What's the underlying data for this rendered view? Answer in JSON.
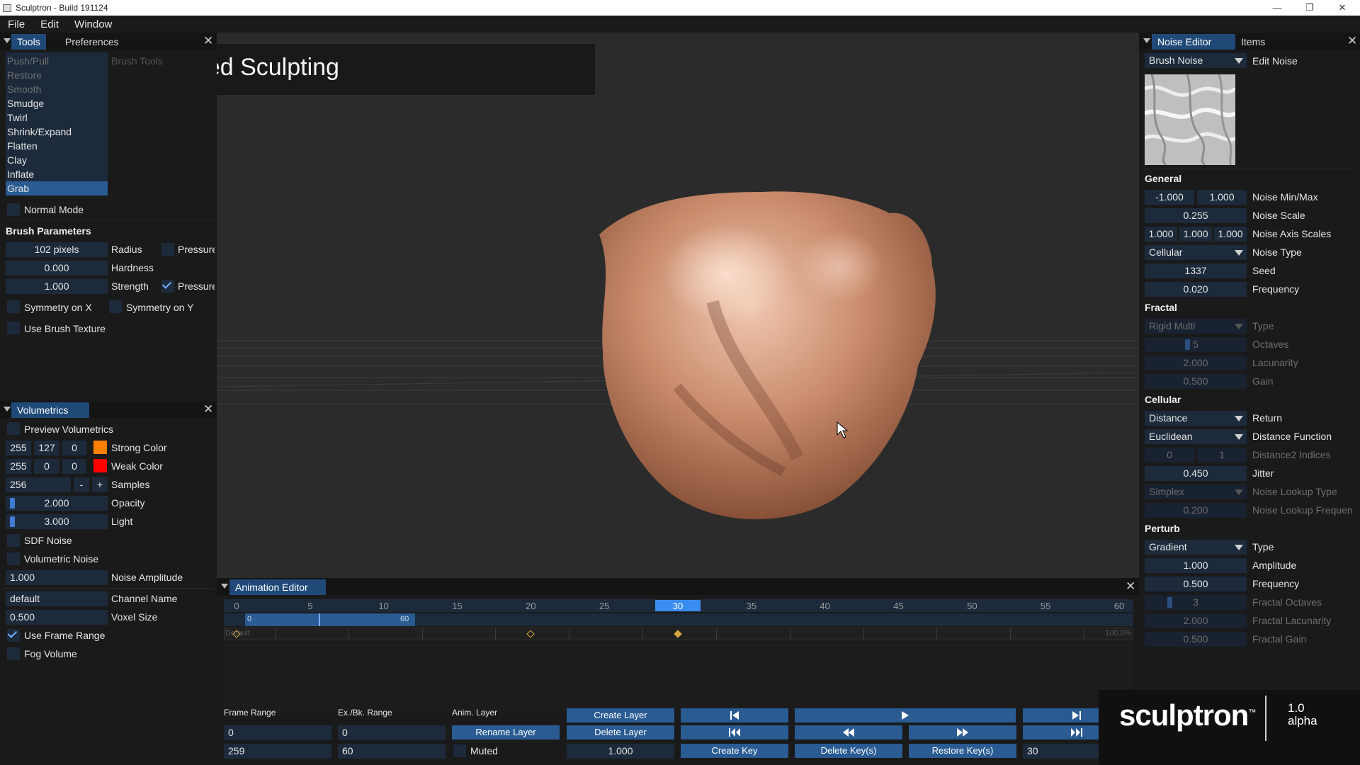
{
  "window": {
    "title": "Sculptron - Build 191124"
  },
  "menu": [
    "File",
    "Edit",
    "Window"
  ],
  "overlay_title": "Animated Sculpting",
  "tools_panel": {
    "tab_tools": "Tools",
    "tab_preferences": "Preferences",
    "brush_tools_header": "Brush Tools",
    "tools": [
      "Push/Pull",
      "Restore",
      "Smooth",
      "Smudge",
      "Twirl",
      "Shrink/Expand",
      "Flatten",
      "Clay",
      "Inflate",
      "Grab"
    ],
    "selected_tool": "Grab",
    "normal_mode": "Normal Mode",
    "brush_parameters": "Brush Parameters",
    "radius_value": "102 pixels",
    "radius_label": "Radius",
    "hardness_value": "0.000",
    "hardness_label": "Hardness",
    "strength_value": "1.000",
    "strength_label": "Strength",
    "pressure_label": "Pressure",
    "symmetry_x": "Symmetry on X",
    "symmetry_y": "Symmetry on Y",
    "use_brush_texture": "Use Brush Texture"
  },
  "volumetrics": {
    "title": "Volumetrics",
    "preview": "Preview Volumetrics",
    "strong_color": {
      "r": "255",
      "g": "127",
      "b": "0",
      "label": "Strong Color",
      "swatch": "#ff7f00"
    },
    "weak_color": {
      "r": "255",
      "g": "0",
      "b": "0",
      "label": "Weak Color",
      "swatch": "#ff0000"
    },
    "samples_value": "256",
    "samples_minus": "-",
    "samples_plus": "+",
    "samples_label": "Samples",
    "opacity_value": "2.000",
    "opacity_label": "Opacity",
    "light_value": "3.000",
    "light_label": "Light",
    "sdf_noise": "SDF Noise",
    "volumetric_noise": "Volumetric Noise",
    "noise_amplitude_value": "1.000",
    "noise_amplitude_label": "Noise Amplitude",
    "channel_name_value": "default",
    "channel_name_label": "Channel Name",
    "voxel_size_value": "0.500",
    "voxel_size_label": "Voxel Size",
    "use_frame_range": "Use Frame Range",
    "fog_volume": "Fog Volume"
  },
  "noise_editor": {
    "tab_noise": "Noise Editor",
    "tab_items": "Items",
    "brush_noise": "Brush Noise",
    "edit_noise": "Edit Noise",
    "general": "General",
    "min": "-1.000",
    "max": "1.000",
    "minmax_label": "Noise Min/Max",
    "scale": "0.255",
    "scale_label": "Noise Scale",
    "axis1": "1.000",
    "axis2": "1.000",
    "axis3": "1.000",
    "axis_label": "Noise Axis Scales",
    "noise_type": "Cellular",
    "noise_type_label": "Noise Type",
    "seed": "1337",
    "seed_label": "Seed",
    "frequency": "0.020",
    "frequency_label": "Frequency",
    "fractal": "Fractal",
    "fractal_type": "Rigid Multi",
    "fractal_type_label": "Type",
    "octaves": "5",
    "octaves_label": "Octaves",
    "lacunarity": "2.000",
    "lacunarity_label": "Lacunarity",
    "gain": "0.500",
    "gain_label": "Gain",
    "cellular": "Cellular",
    "return": "Distance",
    "return_label": "Return",
    "distance_fn": "Euclidean",
    "distance_fn_label": "Distance Function",
    "d2_a": "0",
    "d2_b": "1",
    "d2_label": "Distance2 Indices",
    "jitter": "0.450",
    "jitter_label": "Jitter",
    "lookup_type": "Simplex",
    "lookup_type_label": "Noise Lookup Type",
    "lookup_freq": "0.200",
    "lookup_freq_label": "Noise Lookup Frequen",
    "perturb": "Perturb",
    "perturb_type": "Gradient",
    "perturb_type_label": "Type",
    "amplitude": "1.000",
    "amplitude_label": "Amplitude",
    "p_frequency": "0.500",
    "p_frequency_label": "Frequency",
    "f_octaves": "3",
    "f_octaves_label": "Fractal Octaves",
    "f_lacunarity": "2.000",
    "f_lacunarity_label": "Fractal Lacunarity",
    "f_gain": "0.500",
    "f_gain_label": "Fractal Gain"
  },
  "animation": {
    "title": "Animation Editor",
    "ticks": [
      "0",
      "5",
      "10",
      "15",
      "20",
      "25",
      "30",
      "35",
      "40",
      "45",
      "50",
      "55",
      "60"
    ],
    "current_frame": "30",
    "range_start": "0",
    "range_end": "60",
    "layer_name": "Default",
    "percent": "100.0%",
    "frame_range_label": "Frame Range",
    "exbk_label": "Ex./Bk. Range",
    "anim_layer_label": "Anim. Layer",
    "fr_start": "0",
    "fr_end": "259",
    "ex_start": "0",
    "ex_end": "60",
    "create_layer": "Create Layer",
    "rename_layer": "Rename Layer",
    "delete_layer": "Delete Layer",
    "muted": "Muted",
    "weight": "1.000",
    "create_key": "Create Key",
    "delete_keys": "Delete Key(s)",
    "restore_keys": "Restore Key(s)",
    "frame_field": "30"
  },
  "logo": {
    "name": "sculptron",
    "tm": "™",
    "version": "1.0",
    "stage": "alpha"
  }
}
